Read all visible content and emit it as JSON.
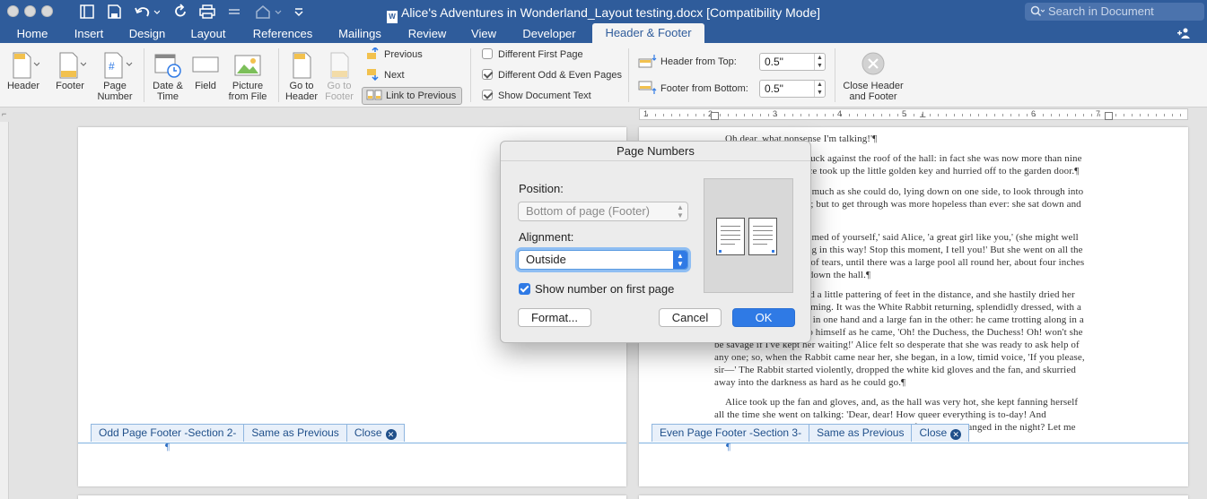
{
  "window": {
    "title": "Alice's Adventures in Wonderland_Layout testing.docx [Compatibility Mode]",
    "search_placeholder": "Search in Document",
    "share_label": "Sh"
  },
  "tabs": [
    "Home",
    "Insert",
    "Design",
    "Layout",
    "References",
    "Mailings",
    "Review",
    "View",
    "Developer",
    "Header & Footer"
  ],
  "active_tab": "Header & Footer",
  "ribbon": {
    "header": "Header",
    "footer": "Footer",
    "page_number": [
      "Page",
      "Number"
    ],
    "date_time": [
      "Date &",
      "Time"
    ],
    "field": "Field",
    "picture_from_file": [
      "Picture",
      "from File"
    ],
    "go_to_header": [
      "Go to",
      "Header"
    ],
    "go_to_footer": [
      "Go to",
      "Footer"
    ],
    "previous": "Previous",
    "next": "Next",
    "link_to_previous": "Link to Previous",
    "different_first_page": "Different First Page",
    "different_odd_even": "Different Odd & Even Pages",
    "show_document_text": "Show Document Text",
    "header_from_top_label": "Header from Top:",
    "header_from_top_value": "0.5\"",
    "footer_from_bottom_label": "Footer from Bottom:",
    "footer_from_bottom_value": "0.5\"",
    "close_header_footer": [
      "Close Header",
      "and Footer"
    ]
  },
  "ruler_numbers": [
    "1",
    "2",
    "3",
    "4",
    "5",
    "6",
    "7"
  ],
  "document": {
    "right_page_lines": [
      "Oh dear, what nonsense I'm talking!'¶",
      "Just then her head struck against the roof of the hall: in fact she was now more than nine",
      "feet high, and she at once took up the little golden key and hurried off to the garden door.¶",
      "Poor Alice! It was as much as she could do, lying down on one side, to look through into",
      "the garden with one eye; but to get through was more hopeless than ever: she sat down and",
      "began to cry again.¶",
      "'You ought to be ashamed of yourself,' said Alice, 'a great girl like you,' (she might well",
      "say this), 'to go on crying in this way! Stop this moment, I tell you!' But she went on all the",
      "same, shedding gallons of tears, until there was a large pool all round her, about four inches",
      "deep and reaching half down the hall.¶",
      "After a time she heard a little pattering of feet in the distance, and she hastily dried her",
      "eyes to see what was coming. It was the White Rabbit returning, splendidly dressed, with a",
      "pair of white kid gloves in one hand and a large fan in the other: he came trotting along in a",
      "great hurry, muttering to himself as he came, 'Oh! the Duchess, the Duchess! Oh! won't she",
      "be savage if I've kept her waiting!' Alice felt so desperate that she was ready to ask help of",
      "any one; so, when the Rabbit came near her, she began, in a low, timid voice, 'If you please,",
      "sir—' The Rabbit started violently, dropped the white kid gloves and the fan, and skurried",
      "away into the darkness as hard as he could go.¶",
      "Alice took up the fan and gloves, and, as the hall was very hot, she kept fanning herself",
      "all the time she went on talking: 'Dear, dear! How queer everything is to-day! And",
      "yesterday things went on just as usual. I wonder if I've been changed in the night? Let me"
    ],
    "pilcrow": "¶"
  },
  "footer_tags": {
    "odd": {
      "label": "Odd Page Footer -Section 2-",
      "same": "Same as Previous",
      "close": "Close"
    },
    "even": {
      "label": "Even Page Footer -Section 3-",
      "same": "Same as Previous",
      "close": "Close"
    }
  },
  "dialog": {
    "title": "Page Numbers",
    "position_label": "Position:",
    "position_value": "Bottom of page (Footer)",
    "alignment_label": "Alignment:",
    "alignment_value": "Outside",
    "show_first_label": "Show number on first page",
    "show_first_checked": true,
    "format_button": "Format...",
    "cancel_button": "Cancel",
    "ok_button": "OK"
  },
  "colors": {
    "titlebar": "#2f5c9b",
    "accent": "#2f7ae5",
    "footer_tag": "#1f4f8a"
  }
}
